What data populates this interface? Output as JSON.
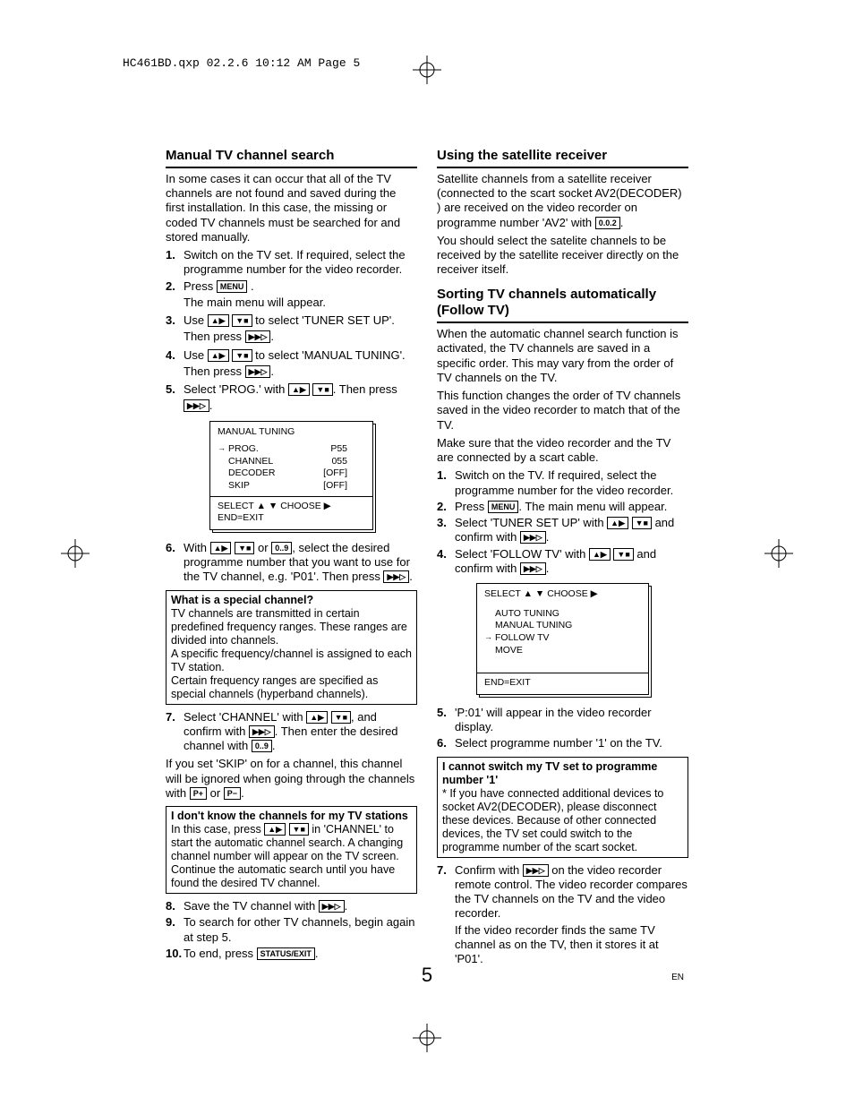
{
  "print_header": "HC461BD.qxp  02.2.6  10:12 AM  Page 5",
  "page_number": "5",
  "lang_code": "EN",
  "left": {
    "h1": "Manual TV channel search",
    "intro": "In some cases it can occur that all of the TV channels are not found and saved during the first installation. In this case, the missing or coded TV channels must be searched for and stored manually.",
    "s1": "Switch on the TV set. If required, select the programme number for the video recorder.",
    "s2a": "Press ",
    "s2b": "The main menu will appear.",
    "s3a": "Use ",
    "s3b": " to select 'TUNER SET UP'.",
    "s3c": "Then press ",
    "s4a": "Use ",
    "s4b": " to select 'MANUAL TUNING'.",
    "s4c": "Then press ",
    "s5a": "Select 'PROG.' with ",
    "s5b": ". Then press ",
    "osd1": {
      "title": "MANUAL TUNING",
      "rows": [
        {
          "k": "PROG.",
          "v": "P55",
          "a": true
        },
        {
          "k": "CHANNEL",
          "v": "055"
        },
        {
          "k": "DECODER",
          "v": "[OFF]"
        },
        {
          "k": "SKIP",
          "v": "[OFF]"
        }
      ],
      "footer1": "SELECT ▲ ▼  CHOOSE ▶",
      "footer2": "END=EXIT"
    },
    "s6a": "With ",
    "s6b": " or ",
    "s6c": ", select the desired programme number that you want to use for the TV channel, e.g. 'P01'. Then press ",
    "note1_h": "What is a special channel?",
    "note1_p1": "TV channels are transmitted in certain predefined frequency ranges. These ranges are divided into channels.",
    "note1_p2": "A specific frequency/channel is assigned to each TV station.",
    "note1_p3": "Certain frequency ranges are specified as special channels (hyperband channels).",
    "s7a": "Select 'CHANNEL' with ",
    "s7b": ", and confirm with ",
    "s7c": ". Then enter the desired channel with ",
    "skip_p": "If you set 'SKIP' on for a channel, this channel will be ignored when going through the channels with ",
    "skip_or": " or ",
    "note2_h": "I don't know the channels for my TV stations",
    "note2_p": "In this case, press ",
    "note2_p2": " in 'CHANNEL' to start the automatic channel search. A changing channel number will appear on the TV screen. Continue the automatic search until you have found the desired TV channel.",
    "s8": "Save the TV channel with ",
    "s9": "To search for other TV channels, begin again at step 5.",
    "s10": "To end, press "
  },
  "right": {
    "h1": "Using the satellite receiver",
    "p1a": "Satellite channels from a satellite receiver (connected to the scart socket AV2(DECODER) ) are received on the video recorder on programme number 'AV2' with ",
    "p2": "You should select the satelite channels to be received by the satellite receiver directly on the receiver itself.",
    "h2": "Sorting TV channels automatically (Follow TV)",
    "p3": "When the automatic channel search function is activated, the TV channels are saved in a specific order. This may vary from the order of TV channels on the TV.",
    "p4": "This function changes the order of TV channels saved in the video recorder to match that of the TV.",
    "p5": "Make sure that the video recorder and the TV are connected by a scart cable.",
    "s1": "Switch on the TV. If required, select the programme number for the video recorder.",
    "s2a": "Press ",
    "s2b": ". The main menu will appear.",
    "s3a": "Select 'TUNER SET UP' with ",
    "s3b": " and confirm with ",
    "s4a": "Select 'FOLLOW TV' with ",
    "s4b": " and confirm with ",
    "osd2": {
      "header": "SELECT ▲ ▼  CHOOSE ▶",
      "items": [
        "AUTO TUNING",
        "MANUAL TUNING",
        "FOLLOW TV",
        "MOVE"
      ],
      "arrow_idx": 2,
      "footer": "END=EXIT"
    },
    "s5": "'P:01' will appear in the video recorder display.",
    "s6": "Select programme number '1' on the TV.",
    "note_h": "I cannot switch my TV set to programme number '1'",
    "note_p": "* If you have connected additional devices to socket AV2(DECODER), please disconnect these devices. Because of other connected devices, the TV set could switch to the programme number of the scart socket.",
    "s7a": "Confirm with ",
    "s7b": " on the video recorder remote control. The video recorder compares the TV channels on the TV and the video recorder.",
    "s7c": "If the video recorder finds the same TV channel as on the TV, then it stores it at 'P01'."
  },
  "keys": {
    "menu": "MENU",
    "digits": "0..9",
    "pplus": "P+",
    "pminus": "P−",
    "status": "STATUS/EXIT",
    "zero02": "0.0.2"
  }
}
